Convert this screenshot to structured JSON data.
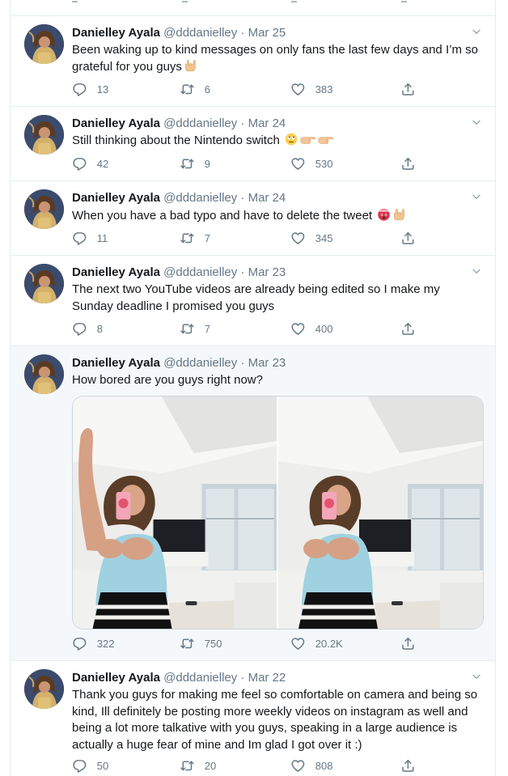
{
  "author": {
    "name": "Danielley Ayala",
    "handle": "@dddanielley"
  },
  "colors": {
    "text": "#14171a",
    "secondary": "#657786",
    "border": "#e6ecf0",
    "hover_bg": "#f5f8fa"
  },
  "icons": {
    "reply": "reply-icon",
    "retweet": "retweet-icon",
    "like": "heart-icon",
    "share": "share-icon",
    "more": "chevron-down-icon"
  },
  "tweets": [
    {
      "date": "· Mar 25",
      "text": "Been waking up to kind messages on only fans the last few days and I’m so grateful for you guys",
      "emoji": [
        "rock-on-hand-emoji"
      ],
      "replies": "13",
      "retweets": "6",
      "likes": "383"
    },
    {
      "date": "· Mar 24",
      "text": "Still thinking about the Nintendo switch",
      "emoji": [
        "face-with-rolling-eyes-emoji",
        "pointing-hand-emoji",
        "pointing-hand-emoji"
      ],
      "replies": "42",
      "retweets": "9",
      "likes": "530"
    },
    {
      "date": "· Mar 24",
      "text": "When you have a bad typo and have to delete the tweet",
      "emoji": [
        "exploding-head-emoji",
        "rock-on-hand-emoji"
      ],
      "replies": "11",
      "retweets": "7",
      "likes": "345"
    },
    {
      "date": "· Mar 23",
      "text": "The next two YouTube videos are already being edited so I make my Sunday deadline I promised you guys",
      "emoji": [],
      "replies": "8",
      "retweets": "7",
      "likes": "400"
    },
    {
      "date": "· Mar 23",
      "text": "How bored are you guys right now?",
      "emoji": [],
      "media": [
        "mirror-selfie-photo-1",
        "mirror-selfie-photo-2"
      ],
      "replies": "322",
      "retweets": "750",
      "likes": "20.2K"
    },
    {
      "date": "· Mar 22",
      "text": "Thank you guys for making me feel so comfortable on camera and being so kind, Ill definitely be posting more weekly videos on instagram as well and being a lot more talkative with you guys, speaking in a large audience is actually a huge fear of mine and Im glad I got over it :)",
      "emoji": [],
      "replies": "50",
      "retweets": "20",
      "likes": "808"
    }
  ]
}
